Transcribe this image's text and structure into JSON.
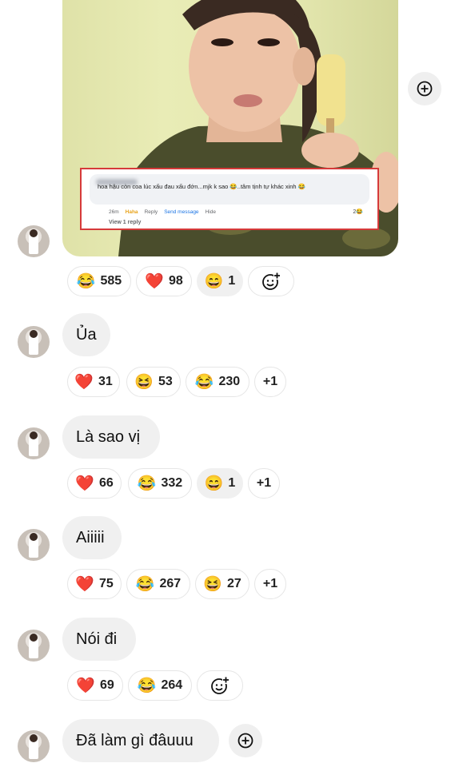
{
  "shared_post": {
    "comment_text": "hoa hậu còn coa lúc xấu đau xấu đớn...mjk k sao 😂..tâm tịnh tự khác xinh 😂",
    "comment_time": "26m",
    "comment_haha": "Haha",
    "comment_reply": "Reply",
    "comment_send_message": "Send message",
    "comment_hide": "Hide",
    "comment_reaction_count": "2",
    "view_replies": "View 1 reply"
  },
  "messages": [
    {
      "text": "",
      "reactions": [
        {
          "emoji": "😂",
          "count": "585"
        },
        {
          "emoji": "❤️",
          "count": "98"
        },
        {
          "emoji": "😄",
          "count": "1"
        }
      ]
    },
    {
      "text": "Ủa",
      "reactions": [
        {
          "emoji": "❤️",
          "count": "31"
        },
        {
          "emoji": "😆",
          "count": "53"
        },
        {
          "emoji": "😂",
          "count": "230"
        },
        {
          "emoji": "",
          "count": "+1"
        }
      ]
    },
    {
      "text": "Là sao vị",
      "reactions": [
        {
          "emoji": "❤️",
          "count": "66"
        },
        {
          "emoji": "😂",
          "count": "332"
        },
        {
          "emoji": "😄",
          "count": "1"
        },
        {
          "emoji": "",
          "count": "+1"
        }
      ]
    },
    {
      "text": "Aiiiii",
      "reactions": [
        {
          "emoji": "❤️",
          "count": "75"
        },
        {
          "emoji": "😂",
          "count": "267"
        },
        {
          "emoji": "😆",
          "count": "27"
        },
        {
          "emoji": "",
          "count": "+1"
        }
      ]
    },
    {
      "text": "Nói đi",
      "reactions": [
        {
          "emoji": "❤️",
          "count": "69"
        },
        {
          "emoji": "😂",
          "count": "264"
        }
      ]
    },
    {
      "text": "Đã làm gì đâuuu",
      "reactions": []
    }
  ],
  "icons": {
    "add_reaction": "smiley-plus-icon",
    "quick_action": "circle-plus-icon"
  },
  "colors": {
    "bubble_bg": "#f0f0f0",
    "comment_border": "#d63a3a",
    "send_message_blue": "#1b74e4",
    "haha_orange": "#e8a31b"
  }
}
